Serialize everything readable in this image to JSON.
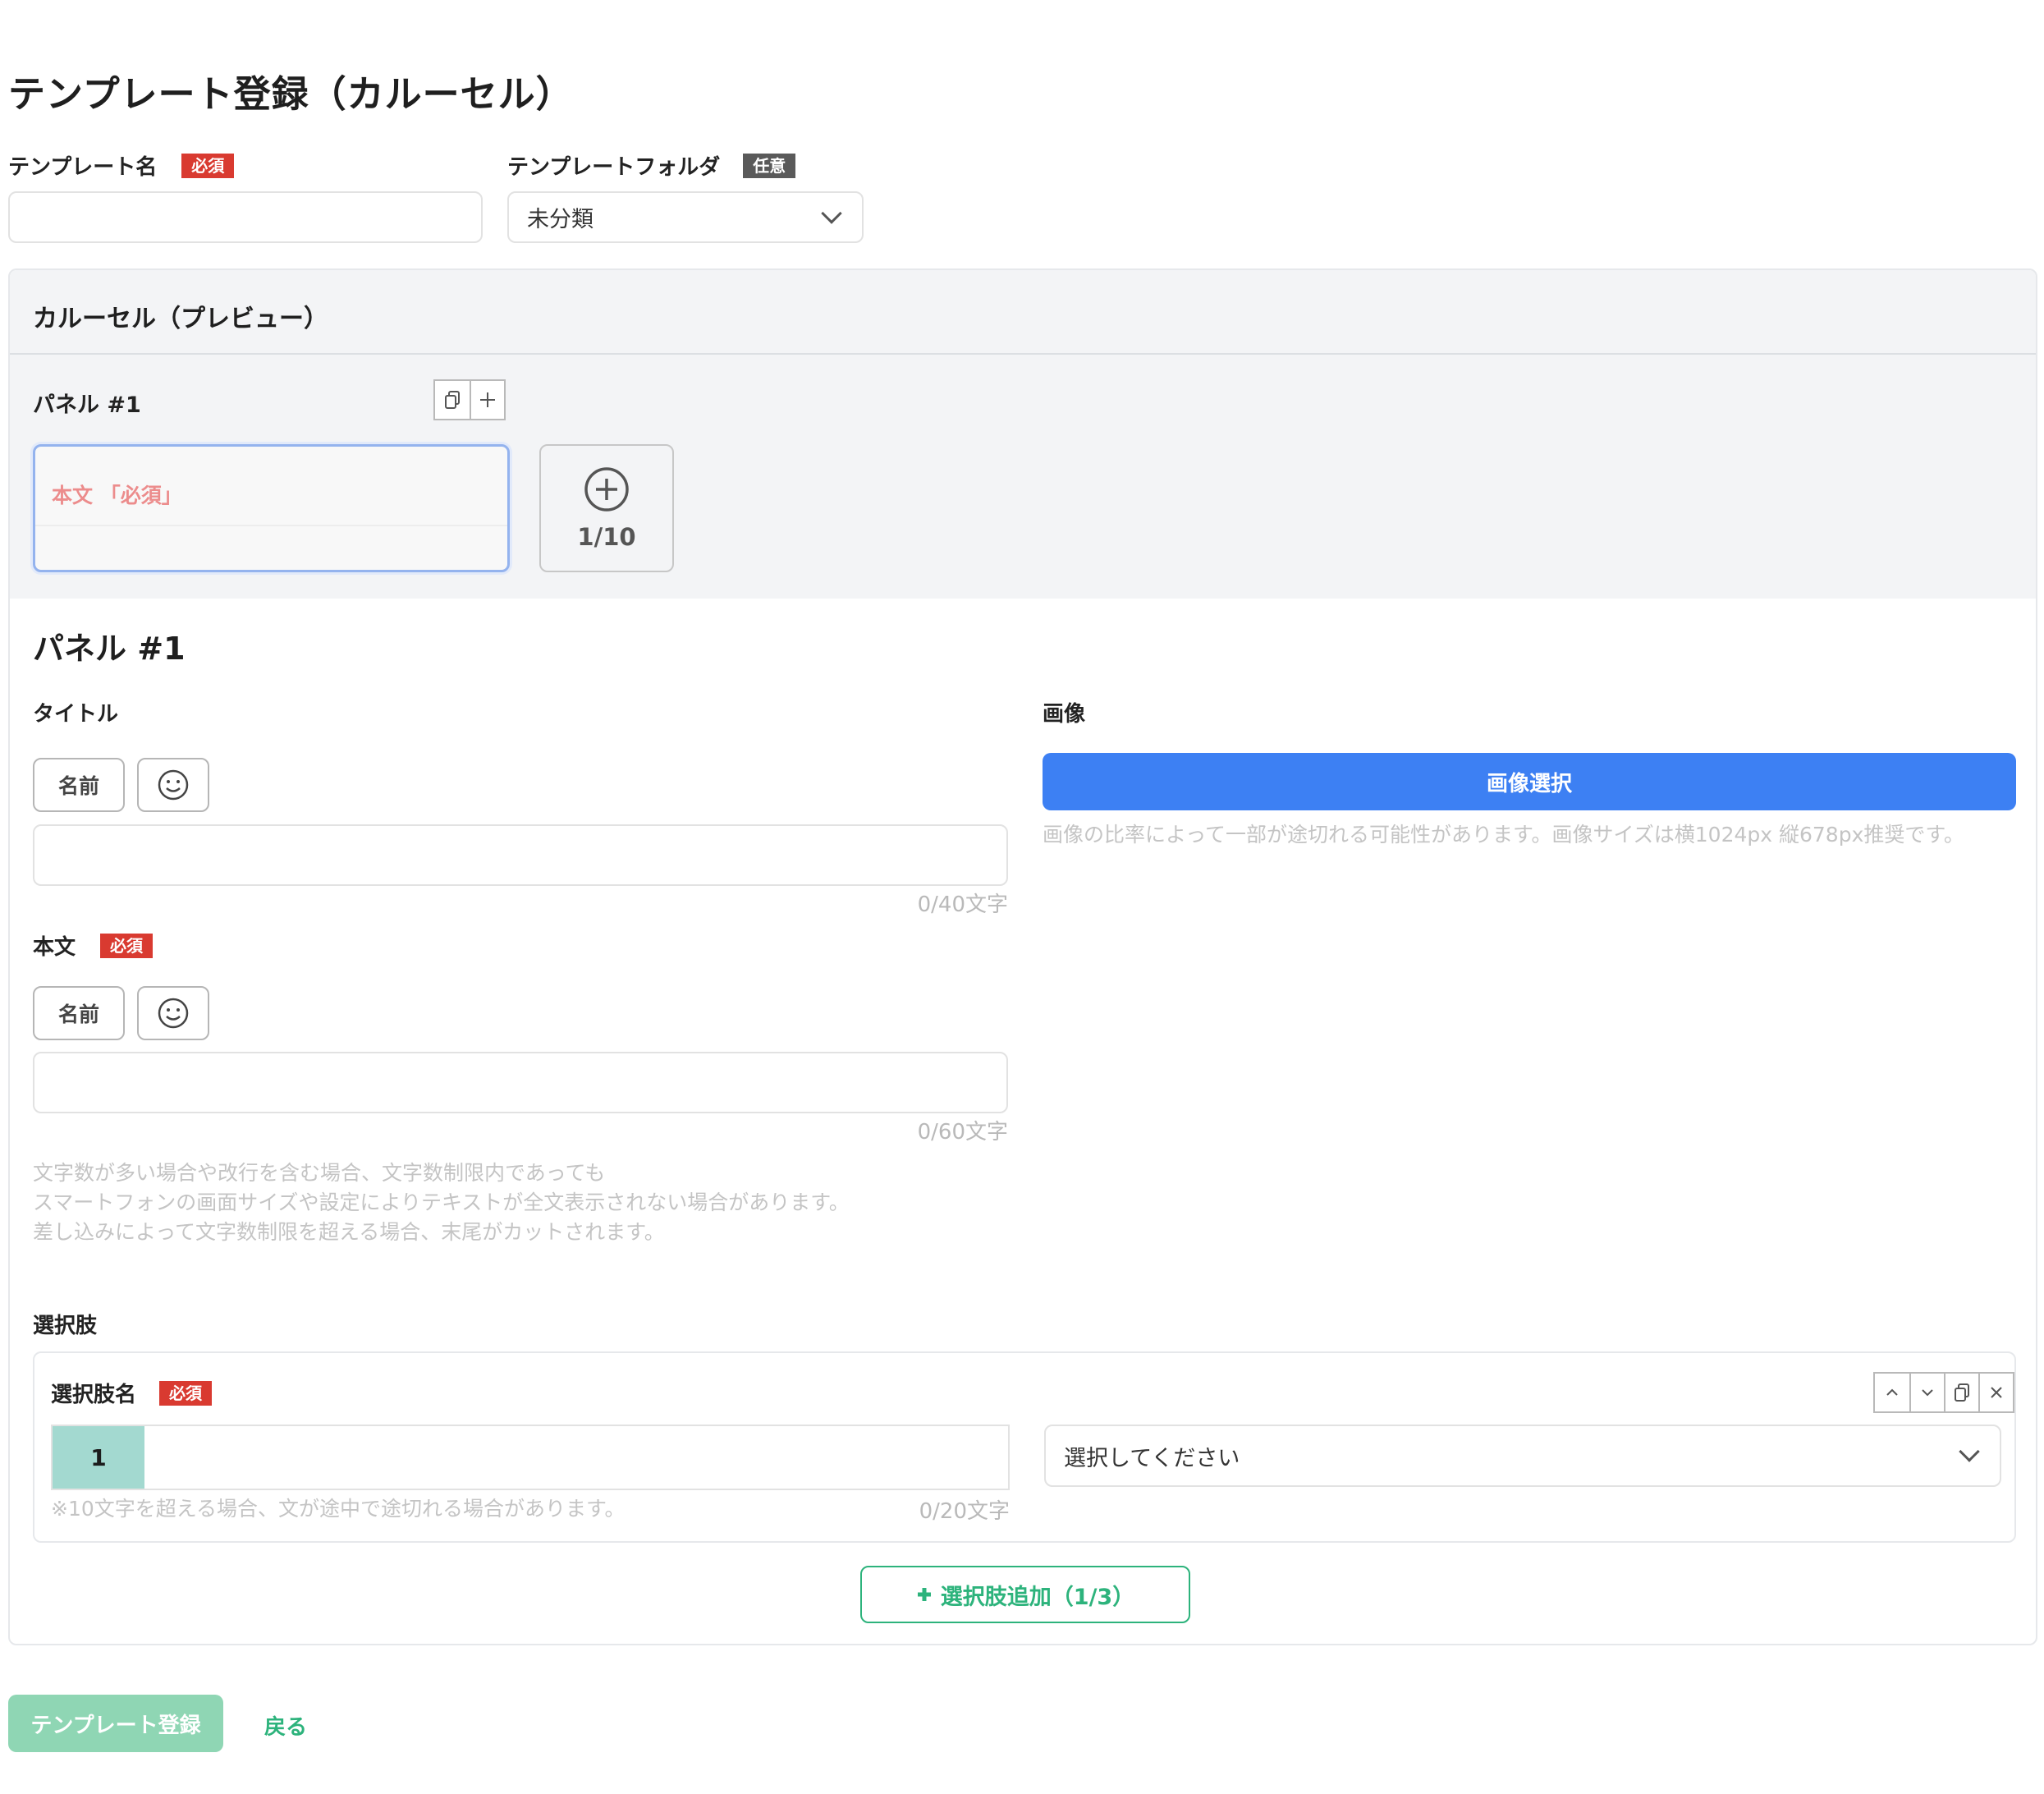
{
  "page": {
    "title": "テンプレート登録（カルーセル）"
  },
  "form": {
    "template_name_label": "テンプレート名",
    "required_badge": "必須",
    "template_name_value": "",
    "folder_label": "テンプレートフォルダ",
    "optional_badge": "任意",
    "folder_value": "未分類"
  },
  "preview": {
    "title": "カルーセル（プレビュー）",
    "panel_label": "パネル #1",
    "panel_body_placeholder": "本文 「必須」",
    "panel_count": "1/10"
  },
  "panel_editor": {
    "heading": "パネル #1",
    "title_label": "タイトル",
    "name_button": "名前",
    "title_counter": "0/40文字",
    "body_label": "本文",
    "body_counter": "0/60文字",
    "body_hint": [
      "文字数が多い場合や改行を含む場合、文字数制限内であっても",
      "スマートフォンの画面サイズや設定によりテキストが全文表示されない場合があります。",
      "差し込みによって文字数制限を超える場合、末尾がカットされます。"
    ],
    "image_label": "画像",
    "image_button": "画像選択",
    "image_hint": "画像の比率によって一部が途切れる可能性があります。画像サイズは横1024px 縦678px推奨です。"
  },
  "choices": {
    "section_label": "選択肢",
    "name_label": "選択肢名",
    "items": [
      {
        "number": "1",
        "value": "",
        "action_placeholder": "選択してください"
      }
    ],
    "note": "※10文字を超える場合、文が途中で途切れる場合があります。",
    "counter": "0/20文字",
    "add_button": "選択肢追加（1/3）"
  },
  "footer": {
    "register_button": "テンプレート登録",
    "back_link": "戻る"
  },
  "colors": {
    "required": "#d93a30",
    "optional": "#5a5a5a",
    "primary": "#3d80f3",
    "accent_green": "#2db37c",
    "register_disabled": "#8fd6b4",
    "choice_number_bg": "#a3d9d0"
  },
  "icons": [
    "copy-icon",
    "plus-icon",
    "plus-circle-icon",
    "smiley-icon",
    "chevron-down-icon",
    "chevron-up-icon",
    "close-icon"
  ]
}
